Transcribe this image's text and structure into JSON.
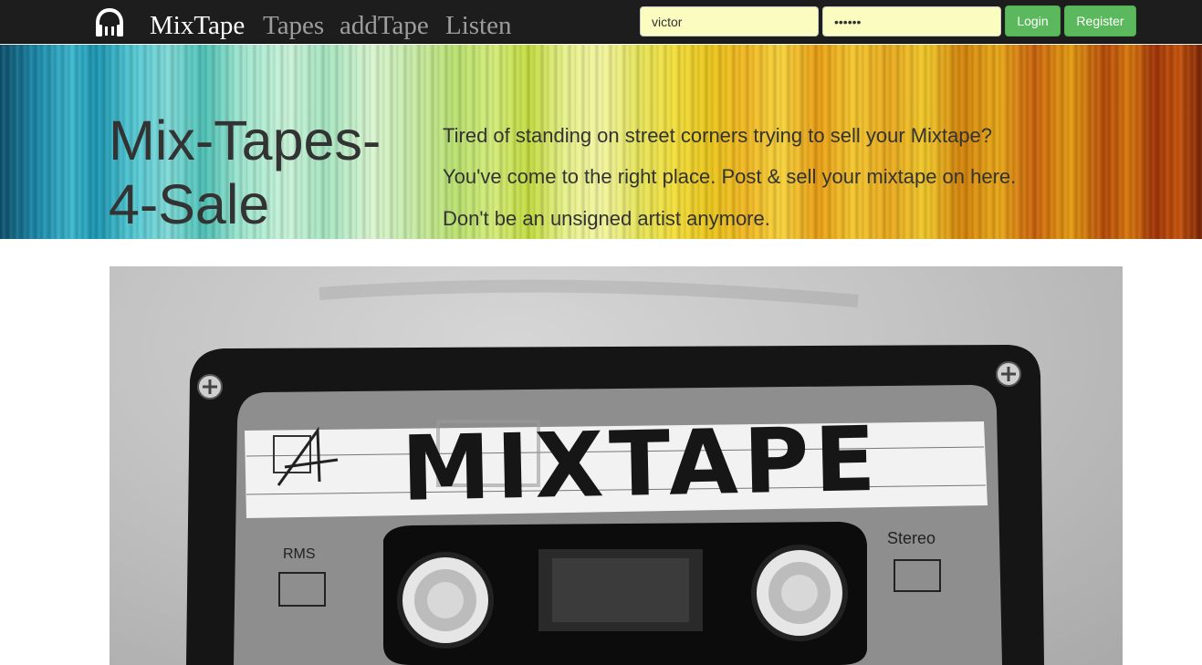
{
  "navbar": {
    "brand": "MixTape",
    "links": [
      "Tapes",
      "addTape",
      "Listen"
    ],
    "username_value": "victor",
    "password_value": "••••••",
    "login_label": "Login",
    "register_label": "Register",
    "brand_icon": "headphones-icon"
  },
  "hero": {
    "title": "Mix-Tapes-4-Sale",
    "lines": [
      "Tired of standing on street corners trying to sell your Mixtape?",
      "You've come to the right place. Post & sell your mixtape on here.",
      "Don't be an unsigned artist anymore."
    ]
  },
  "cassette": {
    "label": "MIXTAPE",
    "left_text": "RMS",
    "right_text": "Stereo"
  },
  "colors": {
    "navbar_bg": "#1d1d1d",
    "input_bg": "#fafdbf",
    "button_green": "#5cb85c",
    "hero_text": "#333333"
  }
}
